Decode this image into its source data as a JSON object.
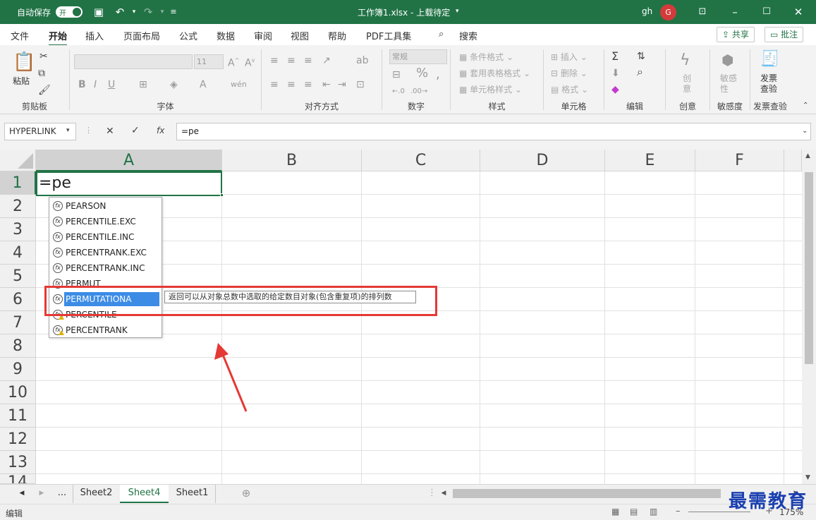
{
  "titlebar": {
    "autosave_label": "自动保存",
    "autosave_state": "开",
    "document_title": "工作簿1.xlsx - 上载待定",
    "user_initials": "gh",
    "avatar_letter": "G"
  },
  "tabs": [
    "文件",
    "开始",
    "插入",
    "页面布局",
    "公式",
    "数据",
    "审阅",
    "视图",
    "帮助",
    "PDF工具集",
    "搜索"
  ],
  "active_tab": "开始",
  "share_label": "共享",
  "comments_label": "批注",
  "ribbon": {
    "clipboard": {
      "paste": "粘贴",
      "group": "剪贴板"
    },
    "font": {
      "size": "11",
      "bold": "B",
      "italic": "I",
      "underline": "U",
      "group": "字体"
    },
    "alignment": {
      "group": "对齐方式"
    },
    "number": {
      "format": "常规",
      "group": "数字"
    },
    "styles": {
      "conditional": "条件格式",
      "table": "套用表格格式",
      "cell": "单元格样式",
      "group": "样式"
    },
    "cells": {
      "insert": "插入",
      "delete": "删除",
      "format": "格式",
      "group": "单元格"
    },
    "editing": {
      "group": "编辑"
    },
    "creative": {
      "label": "创意",
      "group": "创意"
    },
    "sensitivity": {
      "label": "敏感性",
      "group": "敏感度"
    },
    "invoice": {
      "label": "发票查验",
      "group": "发票查验"
    }
  },
  "formula_bar": {
    "name_box": "HYPERLINK",
    "fx": "fx",
    "formula": "=pe"
  },
  "columns": [
    "A",
    "B",
    "C",
    "D",
    "E",
    "F"
  ],
  "rows": [
    "1",
    "2",
    "3",
    "4",
    "5",
    "6",
    "7",
    "8",
    "9",
    "10",
    "11",
    "12",
    "13",
    "14"
  ],
  "active_cell": {
    "ref": "A1",
    "content": "=pe"
  },
  "autocomplete": {
    "items": [
      {
        "name": "PEARSON",
        "warn": false
      },
      {
        "name": "PERCENTILE.EXC",
        "warn": false
      },
      {
        "name": "PERCENTILE.INC",
        "warn": false
      },
      {
        "name": "PERCENTRANK.EXC",
        "warn": false
      },
      {
        "name": "PERCENTRANK.INC",
        "warn": false
      },
      {
        "name": "PERMUT",
        "warn": false
      },
      {
        "name": "PERMUTATIONA",
        "warn": false,
        "selected": true
      },
      {
        "name": "PERCENTILE",
        "warn": true
      },
      {
        "name": "PERCENTRANK",
        "warn": true
      }
    ],
    "tooltip": "返回可以从对象总数中选取的给定数目对象(包含重复项)的排列数"
  },
  "sheets": [
    "...",
    "Sheet2",
    "Sheet4",
    "Sheet1"
  ],
  "active_sheet": "Sheet4",
  "status": {
    "mode": "编辑",
    "zoom": "175%"
  },
  "watermark": "最需教育",
  "colors": {
    "accent": "#217346",
    "highlight": "#e53935",
    "selection": "#3c8ce6"
  }
}
